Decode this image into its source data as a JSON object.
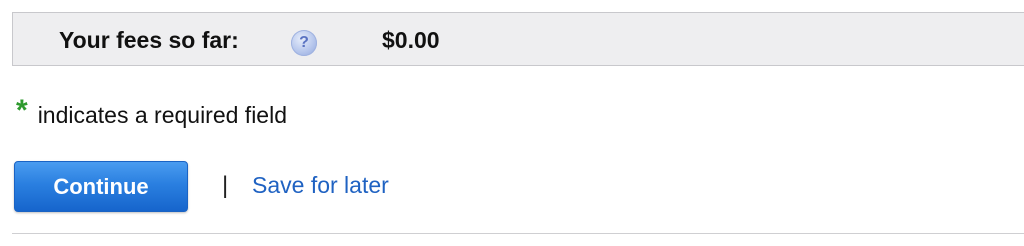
{
  "fees": {
    "label": "Your fees so far:",
    "help_icon_glyph": "?",
    "value": "$0.00"
  },
  "required": {
    "star": "*",
    "text": "indicates a required field",
    "star_color": "#2e9a2e"
  },
  "actions": {
    "continue_label": "Continue",
    "separator": "|",
    "save_label": "Save for later",
    "button_color": "#2a7fe0",
    "link_color": "#1f62c2"
  },
  "icons": {
    "help": "help-icon"
  }
}
